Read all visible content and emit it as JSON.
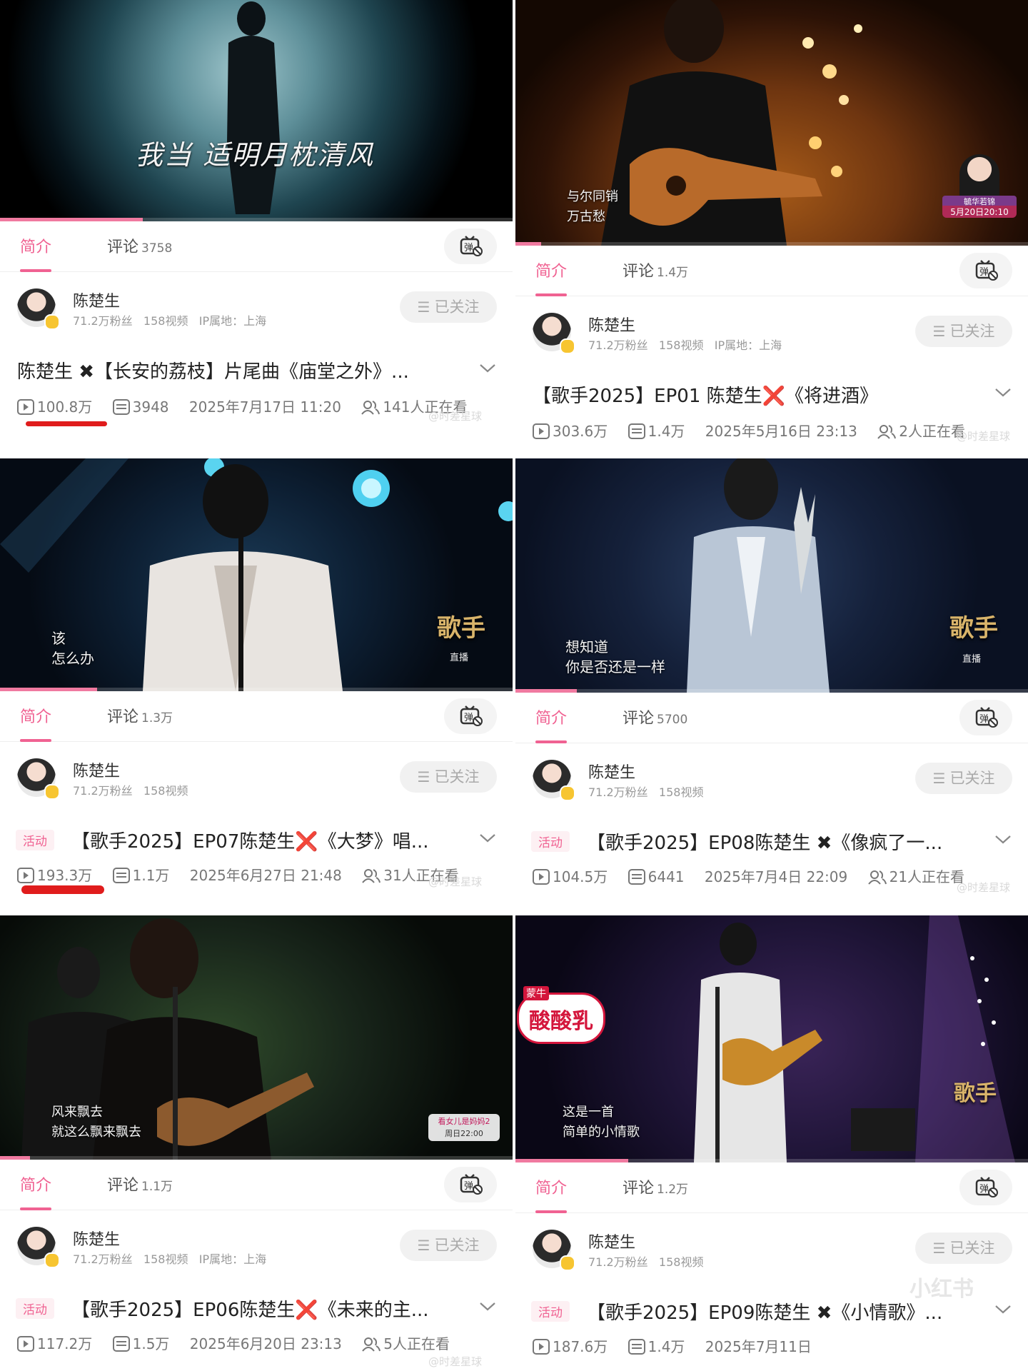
{
  "ui": {
    "tab_intro": "简介",
    "tab_comment": "评论",
    "follow_label": "已关注",
    "activity_tag": "活动",
    "author_name": "陈楚生",
    "followers": "71.2万粉丝",
    "videos_count": "158视频",
    "ip_location": "IP属地：上海",
    "watermark": "@时差星球",
    "show_logo": "歌手",
    "live_label": "直播"
  },
  "cards": [
    {
      "comment_count": "3758",
      "title": "陈楚生 ✖【长安的荔枝】片尾曲《庙堂之外》...",
      "views": "100.8万",
      "danmaku": "3948",
      "date": "2025年7月17日 11:20",
      "watching": "141人正在看",
      "lyric": "我当 适明月枕清风",
      "progress": 0.28,
      "has_ip": true,
      "has_activity": false
    },
    {
      "comment_count": "1.4万",
      "title": "【歌手2025】EP01 陈楚生❌《将进酒》",
      "views": "303.6万",
      "danmaku": "1.4万",
      "date": "2025年5月16日 23:13",
      "watching": "2人正在看",
      "lyric": "与尔同销\n万古愁",
      "promo_name": "毓华若锦",
      "promo_date": "5月20日20:10",
      "progress": 0.05,
      "has_ip": true,
      "has_activity": false
    },
    {
      "comment_count": "1.3万",
      "title": "【歌手2025】EP07陈楚生❌《大梦》唱...",
      "views": "193.3万",
      "danmaku": "1.1万",
      "date": "2025年6月27日 21:48",
      "watching": "31人正在看",
      "lyric": "该\n怎么办",
      "progress": 0.19,
      "has_ip": false,
      "has_activity": true
    },
    {
      "comment_count": "5700",
      "title": "【歌手2025】EP08陈楚生 ✖《像疯了一...",
      "views": "104.5万",
      "danmaku": "6441",
      "date": "2025年7月4日 22:09",
      "watching": "21人正在看",
      "lyric": "想知道\n你是否还是一样",
      "progress": 0.12,
      "has_ip": false,
      "has_activity": true
    },
    {
      "comment_count": "1.1万",
      "title": "【歌手2025】EP06陈楚生❌《未来的主...",
      "views": "117.2万",
      "danmaku": "1.5万",
      "date": "2025年6月20日 23:13",
      "watching": "5人正在看",
      "lyric": "风来飘去\n就这么飘来飘去",
      "promo_name": "看女儿是妈妈2",
      "promo_date": "周日22:00",
      "progress": 0.06,
      "has_ip": true,
      "has_activity": true
    },
    {
      "comment_count": "1.2万",
      "title": "【歌手2025】EP09陈楚生 ✖《小情歌》...",
      "views": "187.6万",
      "danmaku": "1.4万",
      "date": "2025年7月11日",
      "watching": "",
      "lyric": "这是一首\n简单的小情歌",
      "sponsor": "酸酸乳",
      "sponsor_brand": "蒙牛",
      "progress": 0.22,
      "has_ip": false,
      "has_activity": true,
      "overlay_mark": "小红书"
    }
  ]
}
